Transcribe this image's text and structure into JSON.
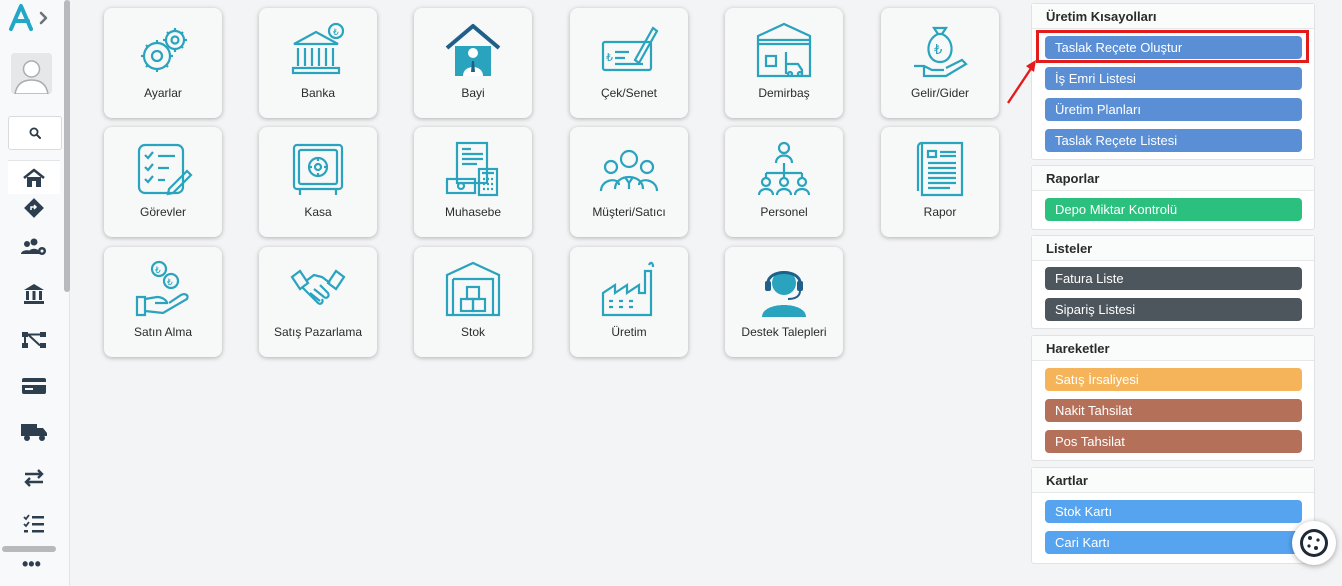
{
  "colors": {
    "teal": "#2aa3bf",
    "blue": "#5a8fd6",
    "green": "#2cc07e",
    "dark": "#4d555d",
    "orange": "#f5b45a",
    "brown": "#b5705a",
    "sky": "#56a3f0",
    "highlight": "#e41b1b"
  },
  "sidebar": {
    "icons": [
      "home-icon",
      "directions-icon",
      "users-gear-icon",
      "bank-icon",
      "network-icon",
      "card-icon",
      "truck-icon",
      "transfer-icon",
      "task-list-icon"
    ],
    "more_label": "•••"
  },
  "tiles": [
    {
      "label": "Ayarlar",
      "icon": "gears-icon"
    },
    {
      "label": "Banka",
      "icon": "bank-building-icon"
    },
    {
      "label": "Bayi",
      "icon": "dealer-house-icon"
    },
    {
      "label": "Çek/Senet",
      "icon": "cheque-icon"
    },
    {
      "label": "Demirbaş",
      "icon": "warehouse-forklift-icon"
    },
    {
      "label": "Gelir/Gider",
      "icon": "money-bag-hand-icon"
    },
    {
      "label": "Görevler",
      "icon": "checklist-icon"
    },
    {
      "label": "Kasa",
      "icon": "safe-icon"
    },
    {
      "label": "Muhasebe",
      "icon": "accounting-icon"
    },
    {
      "label": "Müşteri/Satıcı",
      "icon": "people-group-icon"
    },
    {
      "label": "Personel",
      "icon": "org-chart-icon"
    },
    {
      "label": "Rapor",
      "icon": "report-icon"
    },
    {
      "label": "Satın Alma",
      "icon": "coins-hand-icon"
    },
    {
      "label": "Satış Pazarlama",
      "icon": "handshake-icon"
    },
    {
      "label": "Stok",
      "icon": "stock-boxes-icon"
    },
    {
      "label": "Üretim",
      "icon": "factory-icon"
    },
    {
      "label": "Destek Talepleri",
      "icon": "support-headset-icon"
    }
  ],
  "panels": {
    "uretim": {
      "title": "Üretim Kısayolları",
      "buttons": [
        "Taslak Reçete Oluştur",
        "İş Emri Listesi",
        "Üretim Planları",
        "Taslak Reçete Listesi"
      ]
    },
    "raporlar": {
      "title": "Raporlar",
      "buttons": [
        "Depo Miktar Kontrolü"
      ]
    },
    "listeler": {
      "title": "Listeler",
      "buttons": [
        "Fatura Liste",
        "Sipariş Listesi"
      ]
    },
    "hareketler": {
      "title": "Hareketler",
      "buttons": [
        "Satış İrsaliyesi",
        "Nakit Tahsilat",
        "Pos Tahsilat"
      ]
    },
    "kartlar": {
      "title": "Kartlar",
      "buttons": [
        "Stok Kartı",
        "Cari Kartı"
      ]
    }
  }
}
